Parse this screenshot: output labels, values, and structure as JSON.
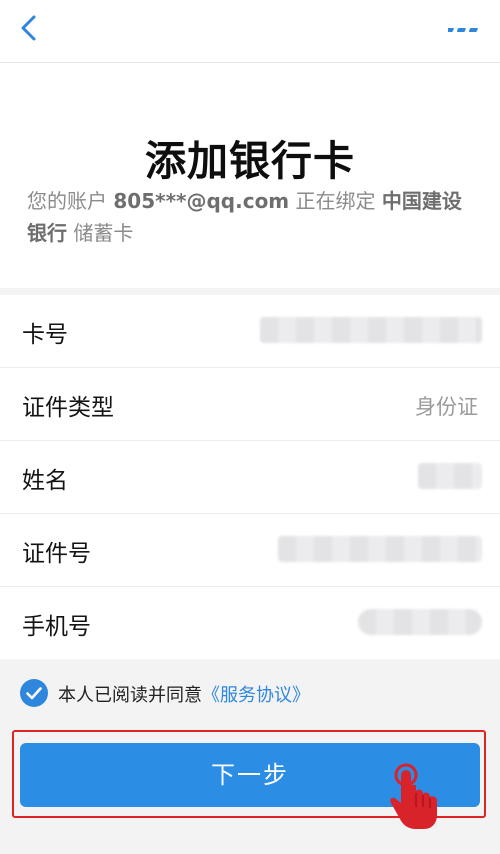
{
  "header": {
    "back_icon": "chevron-left-icon",
    "more_icon": "more-dots-icon"
  },
  "page": {
    "title": "添加银行卡",
    "subtitle_prefix": "您的账户",
    "account": "805***@qq.com",
    "subtitle_mid": "正在绑定",
    "bank": "中国建设银行",
    "card_type": "储蓄卡"
  },
  "form": {
    "card_number": {
      "label": "卡号"
    },
    "id_type": {
      "label": "证件类型",
      "value": "身份证"
    },
    "name": {
      "label": "姓名"
    },
    "id_number": {
      "label": "证件号"
    },
    "phone": {
      "label": "手机号"
    }
  },
  "agreement": {
    "checked": true,
    "text": "本人已阅读并同意",
    "link": "《服务协议》"
  },
  "next_button": {
    "label": "下一步"
  },
  "colors": {
    "accent": "#2f87dd",
    "button": "#2b8de4",
    "highlight": "#e02424"
  }
}
